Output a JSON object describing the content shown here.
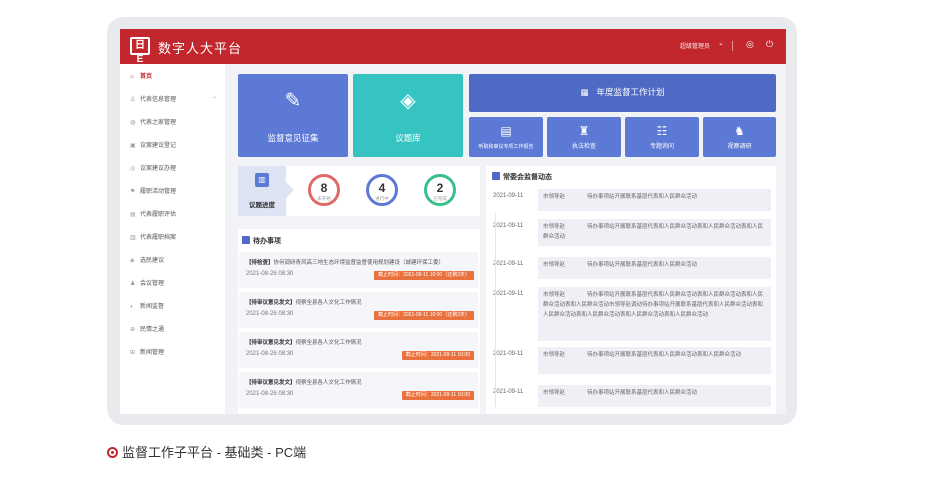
{
  "app": {
    "title": "数字人大平台",
    "user": "超级管理员",
    "logo_text": "日E"
  },
  "sidebar": {
    "items": [
      {
        "label": "首页",
        "icon": "home-icon",
        "glyph": "⌂"
      },
      {
        "label": "代表信息管理",
        "icon": "user-icon",
        "glyph": "♙"
      },
      {
        "label": "代表之家管理",
        "icon": "house-icon",
        "glyph": "◍"
      },
      {
        "label": "议案建议登记",
        "icon": "register-icon",
        "glyph": "▣"
      },
      {
        "label": "议案建议办理",
        "icon": "process-icon",
        "glyph": "◎"
      },
      {
        "label": "履职活动管理",
        "icon": "flag-icon",
        "glyph": "⚑"
      },
      {
        "label": "代表履职评估",
        "icon": "evaluate-icon",
        "glyph": "▤"
      },
      {
        "label": "代表履职档案",
        "icon": "archive-icon",
        "glyph": "▥"
      },
      {
        "label": "选民建议",
        "icon": "voter-icon",
        "glyph": "◈"
      },
      {
        "label": "会议管理",
        "icon": "meeting-icon",
        "glyph": "♟"
      },
      {
        "label": "新闻监督",
        "icon": "news-icon",
        "glyph": "◐"
      },
      {
        "label": "民情之通",
        "icon": "people-icon",
        "glyph": "⊕"
      },
      {
        "label": "新闻管理",
        "icon": "manage-icon",
        "glyph": "⊞"
      }
    ]
  },
  "tiles": {
    "supervision": "监督意见征集",
    "topics": "议题库",
    "annual_plan": "年度监督工作计划",
    "small": [
      {
        "label": "听取和审议专项工作报告",
        "glyph": "▤"
      },
      {
        "label": "执法检查",
        "glyph": "♜"
      },
      {
        "label": "专题询问",
        "glyph": "☷"
      },
      {
        "label": "视察调研",
        "glyph": "♞"
      }
    ]
  },
  "progress": {
    "title": "议题进度",
    "stats": [
      {
        "value": "8",
        "caption": "未开始",
        "color": "#e06a6a"
      },
      {
        "value": "4",
        "caption": "进行中",
        "color": "#5c79d5"
      },
      {
        "value": "2",
        "caption": "已完成",
        "color": "#3bbf8a"
      }
    ]
  },
  "todos": {
    "title": "待办事项",
    "items": [
      {
        "tag": "【待检查】",
        "text": "协何调研青风高三地生态环境监督监督使用规划建设（城建环保工委）",
        "date": "2021-08-26  08:30",
        "deadline": "截止时间：2021-09-11  10:00（还剩3天）"
      },
      {
        "tag": "【待审议意见发文】",
        "text": "视察全县各人文化工作情况",
        "date": "2021-08-26  08:30",
        "deadline": "截止时间：2021-09-11  10:00（还剩3天）"
      },
      {
        "tag": "【待审议意见发文】",
        "text": "视察全县各人文化工作情况",
        "date": "2021-08-26  08:30",
        "deadline": "截止时间：2021-09-11  10:00"
      },
      {
        "tag": "【待审议意见发文】",
        "text": "视察全县各人文化工作情况",
        "date": "2021-08-26  08:30",
        "deadline": "截止时间：2021-09-11  10:00"
      }
    ]
  },
  "news": {
    "title": "常委会监督动态",
    "items": [
      {
        "date": "2021-09-11",
        "text": "市领导赵　　　　待办事项站开展联系基层代表和人民群众活动"
      },
      {
        "date": "2021-09-11",
        "text": "市领导赵　　　　待办事项站开展联系基层代表和人民群众活动表和人民群众活动表和人民群众活动"
      },
      {
        "date": "2021-09-11",
        "text": "市领导赵　　　　待办事项站开展联系基层代表和人民群众活动"
      },
      {
        "date": "2021-09-11",
        "text": "市领导赵　　　　待办事项站开展联系基层代表和人民群众活动表和人民群众活动表和人民群众活动表和人民群众活动市领导赵调动待办事项站开展联系基层代表和人民群众活动表和人民群众活动表和人民群众活动表和人民群众活动表和人民群众活动"
      },
      {
        "date": "2021-09-11",
        "text": "市领导赵　　　　待办事项站开展联系基层代表和人民群众活动表和人民群众活动"
      },
      {
        "date": "2021-09-11",
        "text": "市领导赵　　　　待办事项站开展联系基层代表和人民群众活动"
      }
    ]
  },
  "caption": "监督工作子平台 - 基础类 - PC端"
}
